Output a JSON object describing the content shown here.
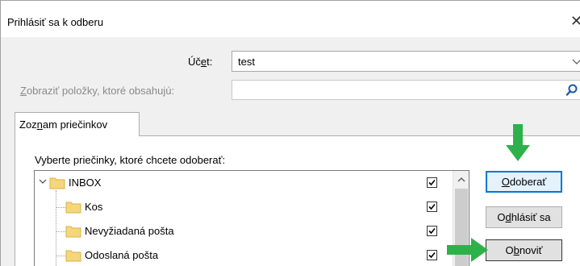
{
  "window": {
    "title": "Prihlásiť sa k odberu",
    "close_glyph": "✕"
  },
  "account": {
    "label_pre": "Úč",
    "label_hot": "e",
    "label_post": "t:",
    "value": "test"
  },
  "filter": {
    "label_hot": "Z",
    "label_post": "obraziť položky, ktoré obsahujú:",
    "value": "",
    "icon": "search-icon"
  },
  "tabs": [
    {
      "pre": "Zoz",
      "hot": "n",
      "post": "am priečinkov"
    }
  ],
  "folders_label": "Vyberte priečinky, ktoré chcete odoberať:",
  "folders": [
    {
      "name": "INBOX",
      "checked": true,
      "expanded": true,
      "level": 0
    },
    {
      "name": "Kos",
      "checked": true,
      "level": 1
    },
    {
      "name": "Nevyžiadaná pošta",
      "checked": true,
      "level": 1
    },
    {
      "name": "Odoslaná pošta",
      "checked": true,
      "level": 1
    }
  ],
  "buttons": {
    "subscribe": {
      "hot": "O",
      "post": "doberať"
    },
    "unsubscribe": {
      "pre": "O",
      "hot": "d",
      "post": "hlásiť sa"
    },
    "refresh": {
      "pre": "O",
      "hot": "b",
      "post": "noviť"
    }
  },
  "colors": {
    "annotation_arrow": "#2eb14a",
    "focus_border": "#0078d7",
    "folder_yellow": "#f5d67a"
  }
}
